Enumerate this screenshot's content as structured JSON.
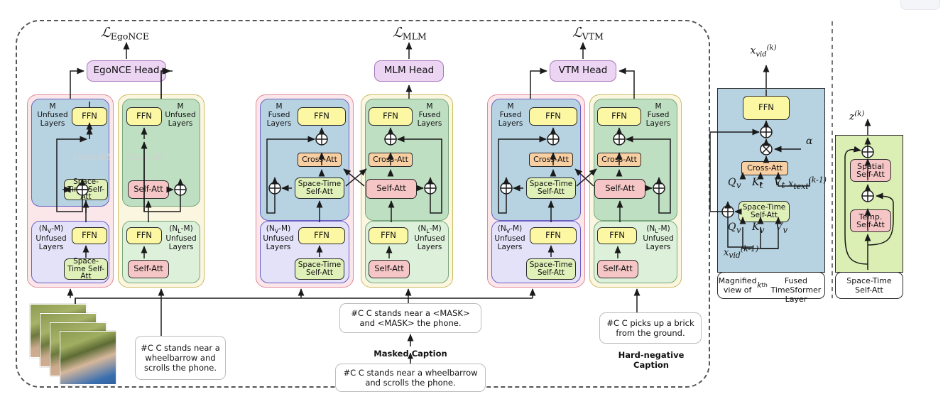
{
  "figure": {
    "losses": {
      "egonce": "ℒEgoNCE",
      "mlm": "ℒMLM",
      "vtm": "ℒVTM"
    },
    "heads": {
      "egonce": "EgoNCE Head",
      "mlm": "MLM Head",
      "vtm": "VTM Head"
    },
    "block_labels": {
      "m_unfused": "M\nUnfused\nLayers",
      "m_fused": "M\nFused\nLayers",
      "nv_unfused": "(NV-M)\nUnfused\nLayers",
      "nl_unfused": "(NL-M)\nUnfused\nLayers"
    },
    "modules": {
      "ffn": "FFN",
      "space_time_self_att": "Space-Time\nSelf-Att",
      "self_att": "Self-Att",
      "cross_att": "Cross-Att",
      "spatial_self_att": "Spatial\nSelf-Att",
      "temp_self_att": "Temp.\nSelf-Att"
    },
    "captions": {
      "positive": "#C C stands near a\nwheelbarrow and\nscrolls the phone.",
      "masked": "#C C stands near a <MASK>\nand <MASK> the phone.",
      "original": "#C C stands near a wheelbarrow\nand scrolls the phone.",
      "hard_negative": "#C C picks up a brick\nfrom the ground.",
      "masked_note": "Masked Caption",
      "hard_negative_note": "Hard-negative\nCaption"
    },
    "magnified": {
      "out_symbol": "x(k)vid",
      "in_symbol": "x(k-1)vid",
      "text_symbol": "x(k-1)text",
      "alpha": "α",
      "qkv_text": [
        "Qv",
        "Kt",
        "Vt"
      ],
      "qkv_vid": [
        "Qv",
        "Kv",
        "Vv"
      ],
      "footer": "Magnified view of kth\nFused TimeSformer Layer"
    },
    "spacetime_panel": {
      "out_symbol": "z(k)",
      "footer": "Space-Time\nSelf-Att"
    },
    "colors": {
      "ffn": "#fbf7a3",
      "space_time": "#dff0b8",
      "self_att": "#f6c6c6",
      "cross_att": "#f8cfa2",
      "head": "#ecd4f3",
      "video_stage": "#b7d3e2",
      "video_stage_light": "#e4e2f8",
      "text_stage": "#bfdfc3",
      "text_stage_light": "#dcf0da",
      "wrap_video": "#fbe7ea",
      "wrap_text": "#fbf6df"
    }
  }
}
